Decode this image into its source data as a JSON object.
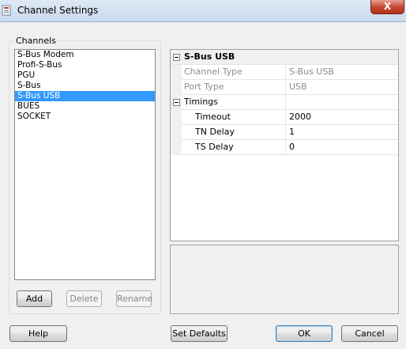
{
  "window": {
    "title": "Channel Settings",
    "close_glyph": "X"
  },
  "channels": {
    "group_label": "Channels",
    "items": [
      "S-Bus Modem",
      "Profi-S-Bus",
      "PGU",
      "S-Bus",
      "S-Bus USB",
      "BUES",
      "SOCKET"
    ],
    "selected": "S-Bus USB",
    "buttons": {
      "add": "Add",
      "delete": "Delete",
      "rename": "Rename"
    }
  },
  "properties": {
    "section_title": "S-Bus USB",
    "channel_type": {
      "name": "Channel Type",
      "value": "S-Bus USB"
    },
    "port_type": {
      "name": "Port Type",
      "value": "USB"
    },
    "timings_title": "Timings",
    "timeout": {
      "name": "Timeout",
      "value": "2000"
    },
    "tn_delay": {
      "name": "TN Delay",
      "value": "1"
    },
    "ts_delay": {
      "name": "TS Delay",
      "value": "0"
    }
  },
  "footer": {
    "help": "Help",
    "set_defaults": "Set Defaults",
    "ok": "OK",
    "cancel": "Cancel"
  },
  "colors": {
    "selection": "#3399ff",
    "disabled_text": "#8c8c8c"
  }
}
